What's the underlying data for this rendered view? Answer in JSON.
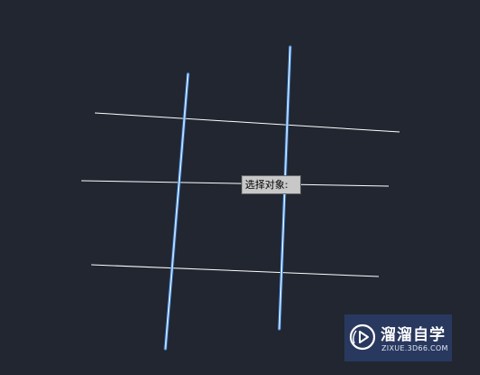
{
  "canvas": {
    "background": "#212630",
    "line_color": "#ffffff",
    "selected_line_color": "#ffffff",
    "selection_glow_color": "#4a8fe0"
  },
  "prompt": {
    "text": "选择对象:"
  },
  "watermark": {
    "title": "溜溜自学",
    "url": "ZIXUE.3D66.COM",
    "logo_icon": "play-icon"
  }
}
